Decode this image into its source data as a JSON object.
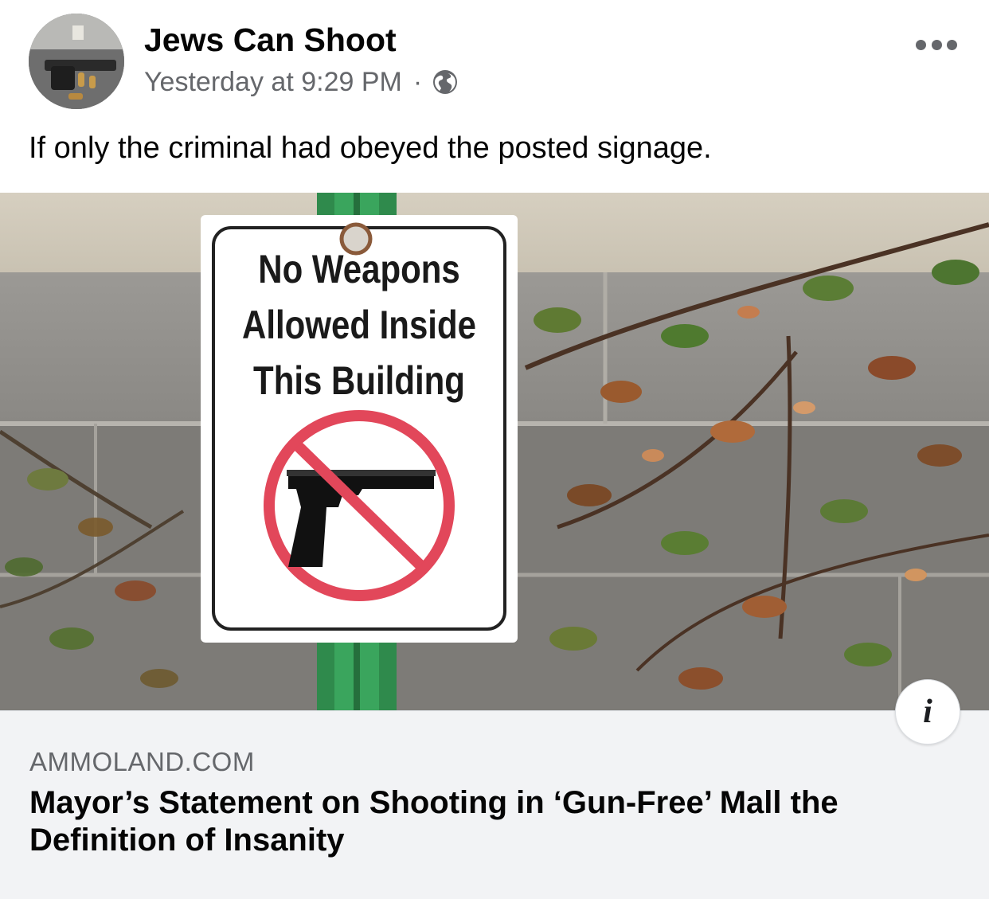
{
  "post": {
    "author": "Jews Can Shoot",
    "timestamp": "Yesterday at 9:29 PM",
    "separator": "·",
    "privacy_icon": "globe-icon",
    "more_icon": "more-horizontal-icon",
    "text": "If only the criminal had obeyed the posted signage."
  },
  "image": {
    "sign_lines": [
      "No Weapons",
      "Allowed Inside",
      "This Building"
    ],
    "sign_symbol": "no-gun-icon"
  },
  "link": {
    "domain": "AMMOLAND.COM",
    "title": "Mayor’s Statement on Shooting in ‘Gun-Free’ Mall the Definition of Insanity",
    "info_label": "i"
  },
  "colors": {
    "name": "#050505",
    "meta": "#65676b",
    "card_bg": "#f2f3f5",
    "prohibition_red": "#e2475a",
    "post_green": "#2e8b4a"
  }
}
